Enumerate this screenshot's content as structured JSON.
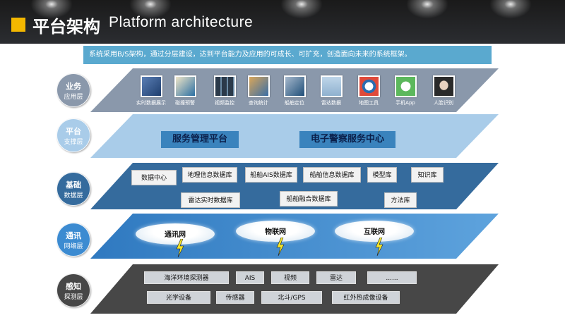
{
  "header": {
    "title_cn": "平台架构",
    "title_en": "Platform  architecture",
    "accent_color": "#f3b700",
    "background_color": "#1f2024"
  },
  "summary": "系统采用B/S架构，通过分层建设，达到平台能力及应用的可成长、可扩充，创造面向未来的系统框架。",
  "layers": {
    "apps": {
      "name_line1": "业务",
      "name_line2": "应用层",
      "color": "#8a98ab",
      "items": [
        {
          "label": "实时数据展示",
          "icon": "monitor-screen-icon"
        },
        {
          "label": "碰撞预警",
          "icon": "video-wall-icon"
        },
        {
          "label": "视频监控",
          "icon": "surveillance-grid-icon"
        },
        {
          "label": "查询统计",
          "icon": "statistics-icon"
        },
        {
          "label": "船舶定位",
          "icon": "ship-position-icon"
        },
        {
          "label": "雷达数据",
          "icon": "radar-tower-icon"
        },
        {
          "label": "地图工具",
          "icon": "map-tool-icon"
        },
        {
          "label": "手机App",
          "icon": "chat-app-icon"
        },
        {
          "label": "人脸识别",
          "icon": "face-recognition-icon"
        }
      ]
    },
    "support": {
      "name_line1": "平台",
      "name_line2": "支撑层",
      "color": "#a9cce9",
      "items": [
        "服务管理平台",
        "电子警察服务中心"
      ]
    },
    "data": {
      "name_line1": "基础",
      "name_line2": "数据层",
      "color": "#356b9d",
      "items": [
        "数据中心",
        "地理信息数据库",
        "船舶AIS数据库",
        "船舶信息数据库",
        "模型库",
        "知识库",
        "雷达实时数据库",
        "船舶融合数据库",
        "方法库"
      ]
    },
    "network": {
      "name_line1": "通讯",
      "name_line2": "网络层",
      "color": "#3c8bd1",
      "items": [
        "通讯网",
        "物联网",
        "互联网"
      ]
    },
    "sensing": {
      "name_line1": "感知",
      "name_line2": "探测层",
      "color": "#474747",
      "items": [
        "海洋环境探测器",
        "AIS",
        "视频",
        "雷达",
        "......",
        "光学设备",
        "传感器",
        "北斗/GPS",
        "红外热成像设备"
      ]
    }
  }
}
